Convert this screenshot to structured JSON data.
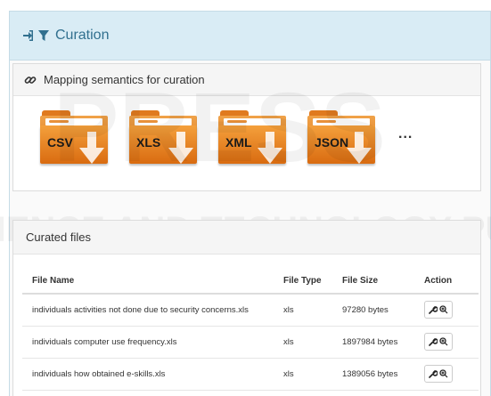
{
  "header": {
    "title": "Curation",
    "icons": [
      "sign-in-icon",
      "filter-icon"
    ],
    "color": "#31708f",
    "bg": "#d9ecf5"
  },
  "mapping": {
    "title": "Mapping semantics for curation",
    "icon": "link-icon",
    "folders": [
      {
        "label": "CSV"
      },
      {
        "label": "XLS"
      },
      {
        "label": "XML"
      },
      {
        "label": "JSON"
      }
    ],
    "more": "..."
  },
  "curated": {
    "title": "Curated files",
    "columns": [
      "File Name",
      "File Type",
      "File Size",
      "Action"
    ],
    "rows": [
      {
        "name": "individuals activities not done due to security concerns.xls",
        "type": "xls",
        "size": "97280 bytes"
      },
      {
        "name": "individuals computer use frequency.xls",
        "type": "xls",
        "size": "1897984 bytes"
      },
      {
        "name": "individuals how obtained e-skills.xls",
        "type": "xls",
        "size": "1389056 bytes"
      }
    ],
    "action_icons": [
      "wrench-icon",
      "search-plus-icon"
    ]
  },
  "watermark": {
    "lines": [
      "SCIENCE AND TECHNOLOGY PUBLICATIONS",
      "PRESS"
    ]
  }
}
